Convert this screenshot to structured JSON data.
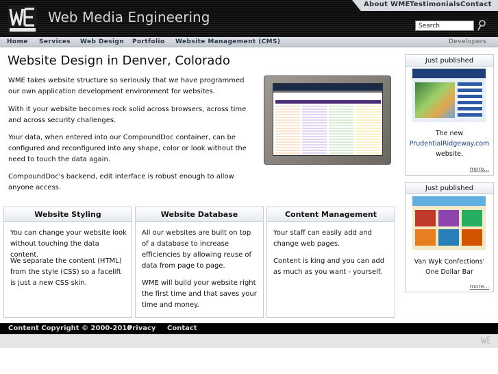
{
  "header": {
    "site_title": "Web Media Engineering",
    "logo_text": "WME"
  },
  "top_nav": {
    "about": "About WME",
    "testimonials": "Testimonials",
    "contact": "Contact"
  },
  "search": {
    "placeholder": "Search"
  },
  "main_nav": {
    "home": "Home",
    "services": "Services",
    "web_design": "Web Design",
    "portfolio": "Portfolio",
    "cms": "Website Management (CMS)",
    "developers": "Developers"
  },
  "content": {
    "heading": "Website Design in Denver, Colorado",
    "p1": "WME takes website structure so seriously that we have programmed our own application development environment for websites.",
    "p2": "With it your website becomes rock solid across browsers, across time and across security challenges.",
    "p3": "Your data, when entered into our CompoundDoc container, can be configured and reconfigured into any shape, color or look without the need to touch the data again.",
    "p4": "CompoundDoc's backend, edit interface is robust enough to allow anyone access."
  },
  "columns": [
    {
      "title": "Website Styling",
      "p1": "You can change your website look without touching the data content.",
      "p2": "We separate the content (HTML) from the style (CSS) so a facelift is just a new CSS skin."
    },
    {
      "title": "Website Database",
      "p1": "All our websites are built on top of a database to increase efficiencies by allowing reuse of data from page to page.",
      "p2": "WME will build your website right the first time and that saves your time and money."
    },
    {
      "title": "Content Management",
      "p1": "Your staff can easily add and change web pages.",
      "p2": "Content is king and you can add as much as you want - yourself."
    }
  ],
  "sidebar": [
    {
      "title": "Just published",
      "text_before": "The new",
      "link": "PrudentialRidgeway.com",
      "text_after": "website.",
      "more": "more..."
    },
    {
      "title": "Just published",
      "line1": "Van Wyk Confections'",
      "line2": "One Dollar Bar",
      "more": "more..."
    }
  ],
  "footer": {
    "copyright": "Content Copyright © 2000-2010",
    "privacy": "Privacy",
    "contact": "Contact"
  }
}
